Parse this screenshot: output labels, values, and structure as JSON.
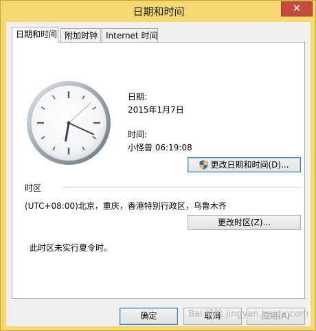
{
  "window": {
    "title": "日期和时间",
    "close_glyph": "✕"
  },
  "tabs": [
    {
      "label": "日期和时间"
    },
    {
      "label": "附加时钟"
    },
    {
      "label": "Internet 时间"
    }
  ],
  "datetime": {
    "date_label": "日期:",
    "date_value": "2015年1月7日",
    "time_label": "时间:",
    "time_value": "小怪兽 06:19:08",
    "change_button": "更改日期和时间(D)..."
  },
  "timezone": {
    "section_label": "时区",
    "value": "(UTC+08:00)北京，重庆，香港特别行政区，乌鲁木齐",
    "change_button": "更改时区(Z)...",
    "dst_note": "此时区未实行夏令时。"
  },
  "footer": {
    "ok": "确定",
    "cancel": "取消",
    "apply": "应用(A)"
  },
  "watermark": "Bai 经验 jingyan.baidu.com",
  "clock": {
    "hours": 6,
    "minutes": 19,
    "seconds": 8
  },
  "icons": {
    "shield": "uac-shield-icon",
    "close": "close-icon"
  }
}
